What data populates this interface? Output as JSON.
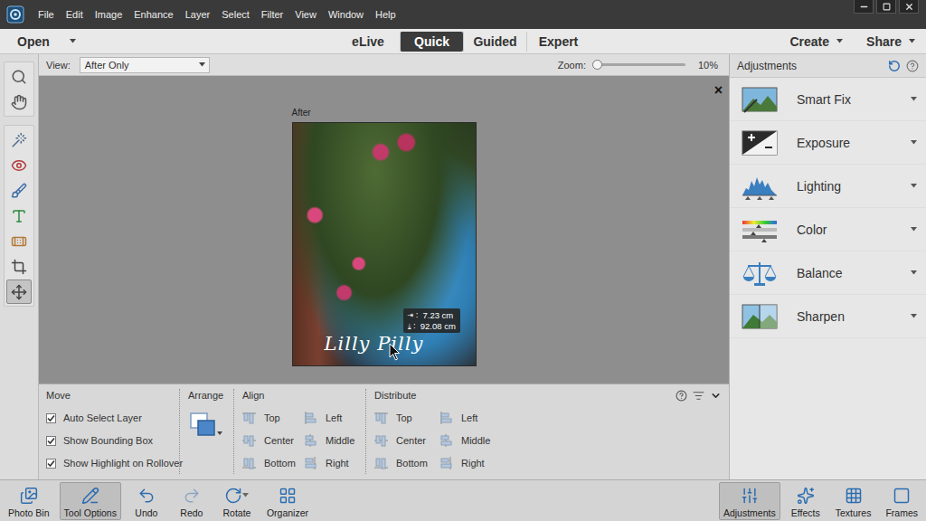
{
  "menu_bar": {
    "items": [
      "File",
      "Edit",
      "Image",
      "Enhance",
      "Layer",
      "Select",
      "Filter",
      "View",
      "Window",
      "Help"
    ]
  },
  "mode_bar": {
    "open": "Open",
    "modes": [
      {
        "label": "eLive",
        "selected": false
      },
      {
        "label": "Quick",
        "selected": true
      },
      {
        "label": "Guided",
        "selected": false
      },
      {
        "label": "Expert",
        "selected": false
      }
    ],
    "actions": [
      "Create",
      "Share"
    ]
  },
  "tools": [
    {
      "kind": "zoom",
      "selected": false
    },
    {
      "kind": "hand",
      "selected": false
    },
    {
      "kind": "quickselect",
      "selected": false
    },
    {
      "kind": "redeye",
      "selected": false
    },
    {
      "kind": "whiten",
      "selected": false
    },
    {
      "kind": "type",
      "selected": false
    },
    {
      "kind": "heal",
      "selected": false
    },
    {
      "kind": "crop",
      "selected": false
    },
    {
      "kind": "move",
      "selected": true
    }
  ],
  "options_bar": {
    "view_label": "View:",
    "view_value": "After Only",
    "zoom_label": "Zoom:",
    "zoom_level": 0.0,
    "zoom_value": "10%"
  },
  "canvas": {
    "label": "After",
    "close": "×",
    "text_layer": "Lilly Pilly",
    "tooltip": [
      {
        "axis": "⇥ :",
        "value": "7.23 cm"
      },
      {
        "axis": "⤓ :",
        "value": "92.08 cm"
      }
    ]
  },
  "tool_options": {
    "move": {
      "title": "Move",
      "checkboxes": [
        {
          "label": "Auto Select Layer",
          "checked": true
        },
        {
          "label": "Show Bounding Box",
          "checked": true
        },
        {
          "label": "Show Highlight on Rollover",
          "checked": true
        }
      ]
    },
    "arrange": {
      "title": "Arrange"
    },
    "align": {
      "title": "Align",
      "columns": [
        [
          "Top",
          "Center",
          "Bottom"
        ],
        [
          "Left",
          "Middle",
          "Right"
        ]
      ]
    },
    "distribute": {
      "title": "Distribute",
      "columns": [
        [
          "Top",
          "Center",
          "Bottom"
        ],
        [
          "Left",
          "Middle",
          "Right"
        ]
      ]
    }
  },
  "adjustments": {
    "title": "Adjustments",
    "items": [
      {
        "label": "Smart Fix",
        "kind": "smartfix"
      },
      {
        "label": "Exposure",
        "kind": "exposure"
      },
      {
        "label": "Lighting",
        "kind": "lighting"
      },
      {
        "label": "Color",
        "kind": "color"
      },
      {
        "label": "Balance",
        "kind": "balance"
      },
      {
        "label": "Sharpen",
        "kind": "sharpen"
      }
    ]
  },
  "bottom_bar": {
    "left": [
      {
        "label": "Photo Bin",
        "kind": "photobin",
        "selected": false
      },
      {
        "label": "Tool Options",
        "kind": "tooloptions",
        "selected": true
      },
      {
        "label": "Undo",
        "kind": "undo",
        "selected": false
      },
      {
        "label": "Redo",
        "kind": "redo",
        "selected": false
      },
      {
        "label": "Rotate",
        "kind": "rotate",
        "selected": false
      },
      {
        "label": "Organizer",
        "kind": "organizer",
        "selected": false
      }
    ],
    "right": [
      {
        "label": "Adjustments",
        "kind": "adjustments",
        "selected": true
      },
      {
        "label": "Effects",
        "kind": "effects",
        "selected": false
      },
      {
        "label": "Textures",
        "kind": "textures",
        "selected": false
      },
      {
        "label": "Frames",
        "kind": "frames",
        "selected": false
      }
    ]
  }
}
